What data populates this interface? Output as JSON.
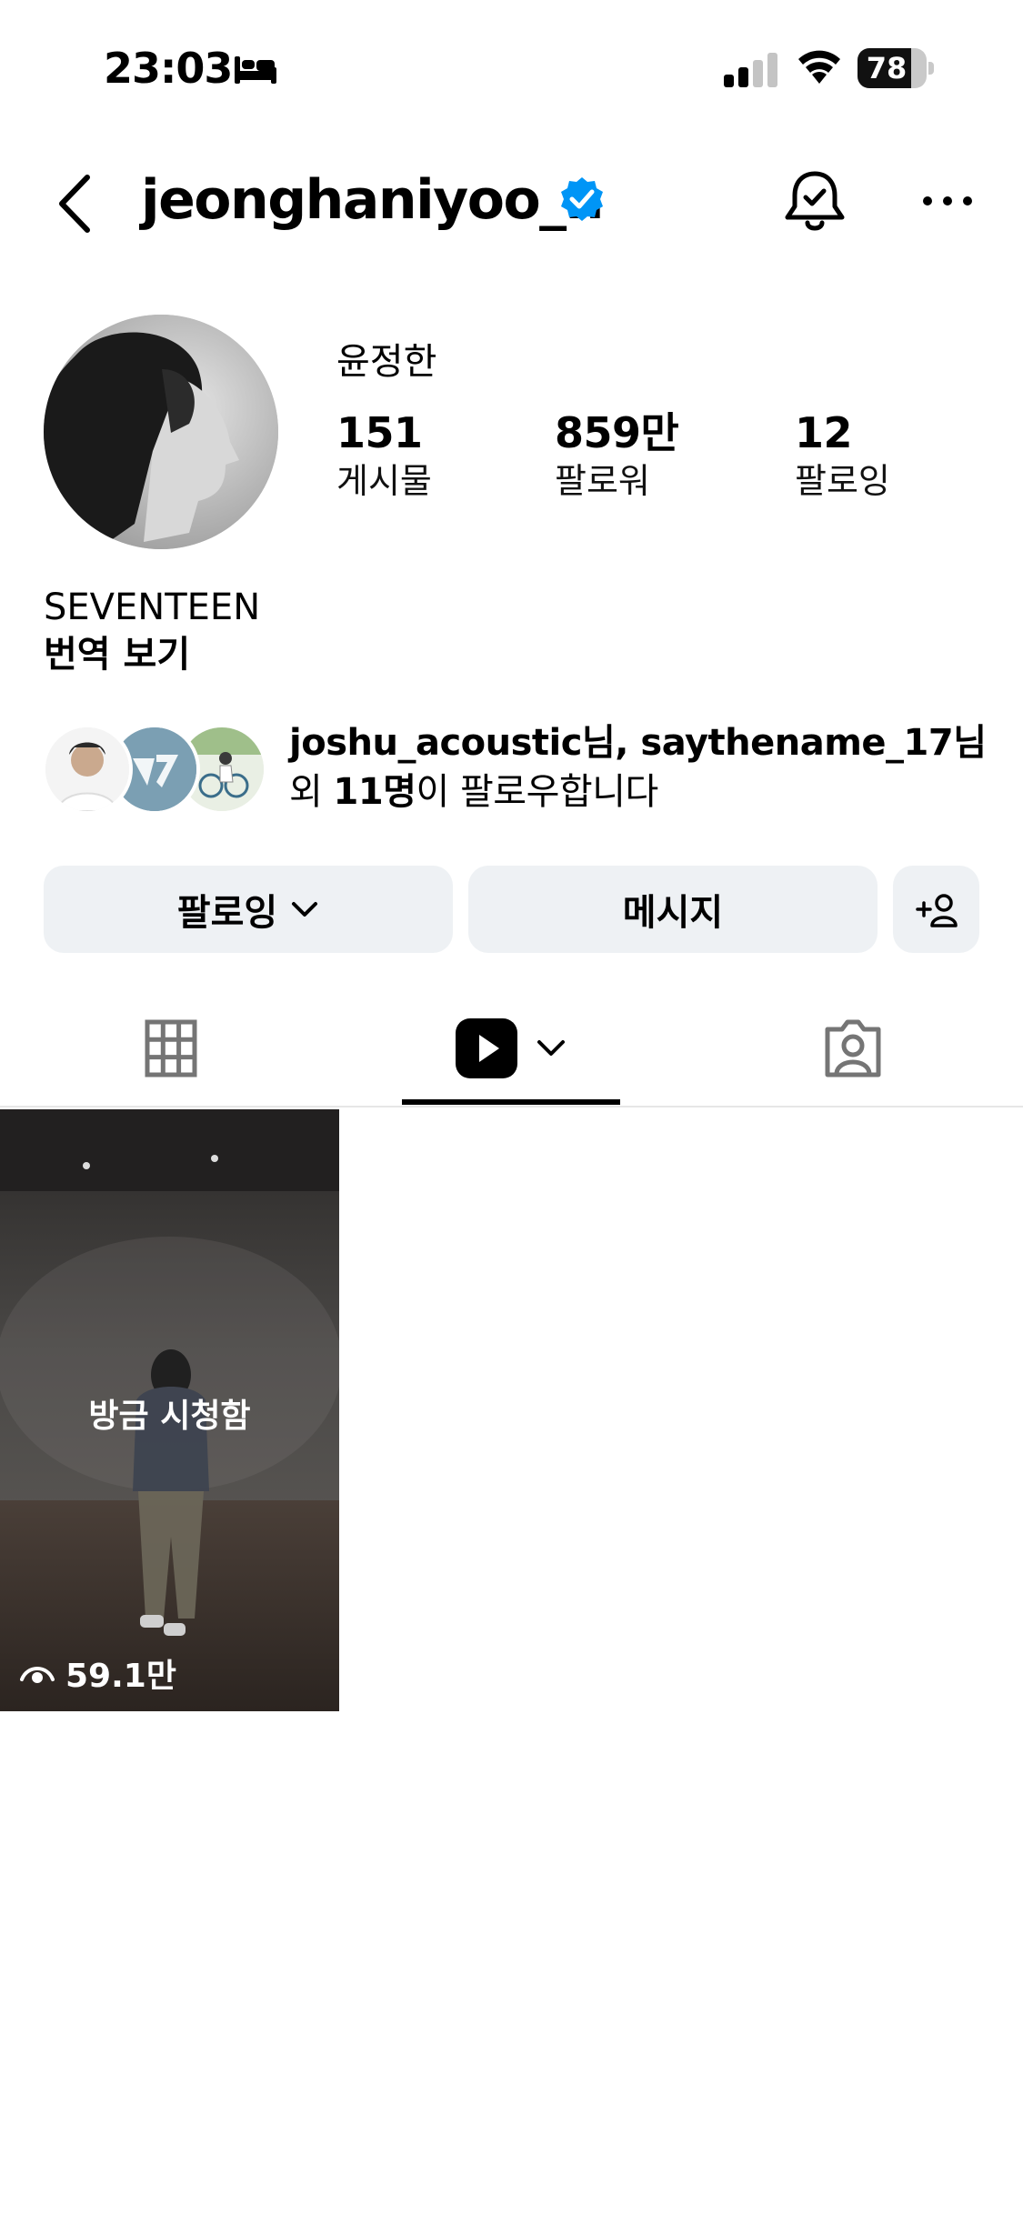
{
  "status_bar": {
    "time": "23:03",
    "battery": "78",
    "battery_level": 0.78,
    "icons": [
      "sleep-focus-icon",
      "cellular-signal-icon",
      "wifi-icon",
      "battery-icon"
    ]
  },
  "header": {
    "username": "jeonghaniyoo_n",
    "icons": [
      "back-arrow-icon",
      "verified-badge-icon",
      "notification-bell-icon",
      "more-options-icon"
    ]
  },
  "profile": {
    "display_name": "윤정한",
    "stats": {
      "posts": {
        "value": "151",
        "label": "게시물"
      },
      "followers": {
        "value": "859만",
        "label": "팔로워"
      },
      "following": {
        "value": "12",
        "label": "팔로잉"
      }
    },
    "bio": "SEVENTEEN",
    "translate_label": "번역 보기"
  },
  "mutual": {
    "line1": "joshu_acoustic님, saythename_17님",
    "line2_prefix": "외 ",
    "line2_count": "11명",
    "line2_suffix": "이 팔로우합니다"
  },
  "actions": {
    "following_label": "팔로잉",
    "message_label": "메시지",
    "add_user_label": "+person"
  },
  "tabs": {
    "items": [
      "grid-tab",
      "reels-tab",
      "tagged-tab"
    ],
    "active": "reels-tab"
  },
  "reels": [
    {
      "status": "방금 시청함",
      "views": "59.1만"
    }
  ],
  "colors": {
    "verified": "#0095f6",
    "button_bg": "#eef1f4",
    "divider": "#e6e6e6"
  }
}
